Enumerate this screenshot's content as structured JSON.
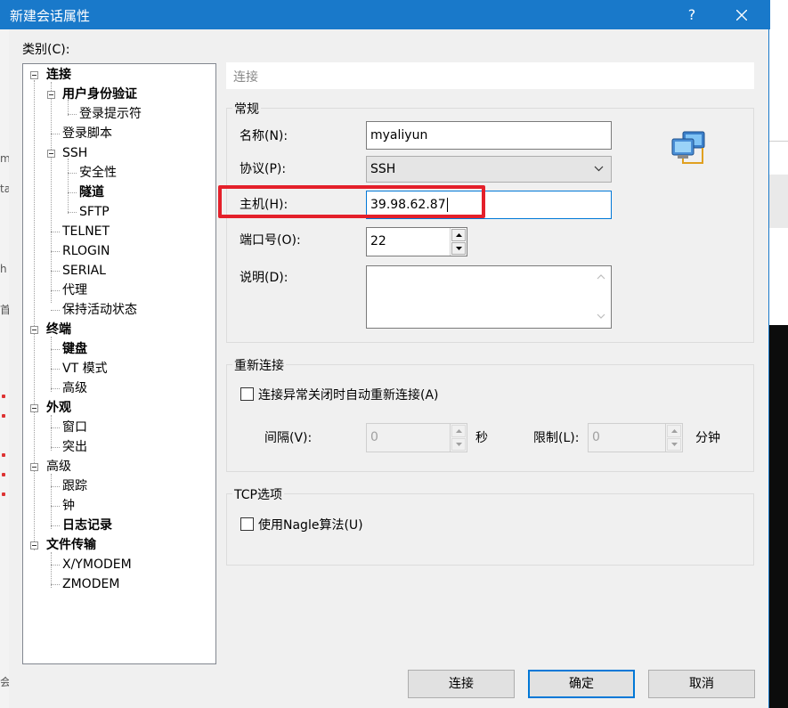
{
  "window": {
    "title": "新建会话属性",
    "help_label": "?",
    "close_icon": "close-icon"
  },
  "category_label": "类别(C):",
  "tree": {
    "items": [
      {
        "label": "连接",
        "bold": true
      },
      {
        "label": "用户身份验证",
        "bold": true
      },
      {
        "label": "登录提示符",
        "bold": false
      },
      {
        "label": "登录脚本",
        "bold": false
      },
      {
        "label": "SSH",
        "bold": false
      },
      {
        "label": "安全性",
        "bold": false
      },
      {
        "label": "隧道",
        "bold": true
      },
      {
        "label": "SFTP",
        "bold": false
      },
      {
        "label": "TELNET",
        "bold": false
      },
      {
        "label": "RLOGIN",
        "bold": false
      },
      {
        "label": "SERIAL",
        "bold": false
      },
      {
        "label": "代理",
        "bold": false
      },
      {
        "label": "保持活动状态",
        "bold": false
      },
      {
        "label": "终端",
        "bold": true
      },
      {
        "label": "键盘",
        "bold": true
      },
      {
        "label": "VT 模式",
        "bold": false
      },
      {
        "label": "高级",
        "bold": false
      },
      {
        "label": "外观",
        "bold": true
      },
      {
        "label": "窗口",
        "bold": false
      },
      {
        "label": "突出",
        "bold": false
      },
      {
        "label": "高级",
        "bold": false
      },
      {
        "label": "跟踪",
        "bold": false
      },
      {
        "label": "钟",
        "bold": false
      },
      {
        "label": "日志记录",
        "bold": true
      },
      {
        "label": "文件传输",
        "bold": true
      },
      {
        "label": "X/YMODEM",
        "bold": false
      },
      {
        "label": "ZMODEM",
        "bold": false
      }
    ]
  },
  "panel": {
    "header": "连接",
    "general": {
      "title": "常规",
      "name_label": "名称(N):",
      "name_value": "myaliyun",
      "protocol_label": "协议(P):",
      "protocol_value": "SSH",
      "host_label": "主机(H):",
      "host_value": "39.98.62.87",
      "port_label": "端口号(O):",
      "port_value": "22",
      "description_label": "说明(D):",
      "description_value": "",
      "icon": "network-computers-icon"
    },
    "reconnect": {
      "title": "重新连接",
      "auto_reconnect_label": "连接异常关闭时自动重新连接(A)",
      "auto_reconnect_checked": false,
      "interval_label": "间隔(V):",
      "interval_value": "0",
      "interval_unit": "秒",
      "limit_label": "限制(L):",
      "limit_value": "0",
      "limit_unit": "分钟"
    },
    "tcp": {
      "title": "TCP选项",
      "nagle_label": "使用Nagle算法(U)",
      "nagle_checked": false
    }
  },
  "buttons": {
    "connect": "连接",
    "ok": "确定",
    "cancel": "取消"
  },
  "background": {
    "frag1": "m",
    "frag2": "ta",
    "frag3": "h",
    "frag4": "首",
    "frag5": "会"
  },
  "colors": {
    "titlebar": "#1979ca",
    "highlight": "#e4202a",
    "default_button_border": "#0078d7"
  }
}
